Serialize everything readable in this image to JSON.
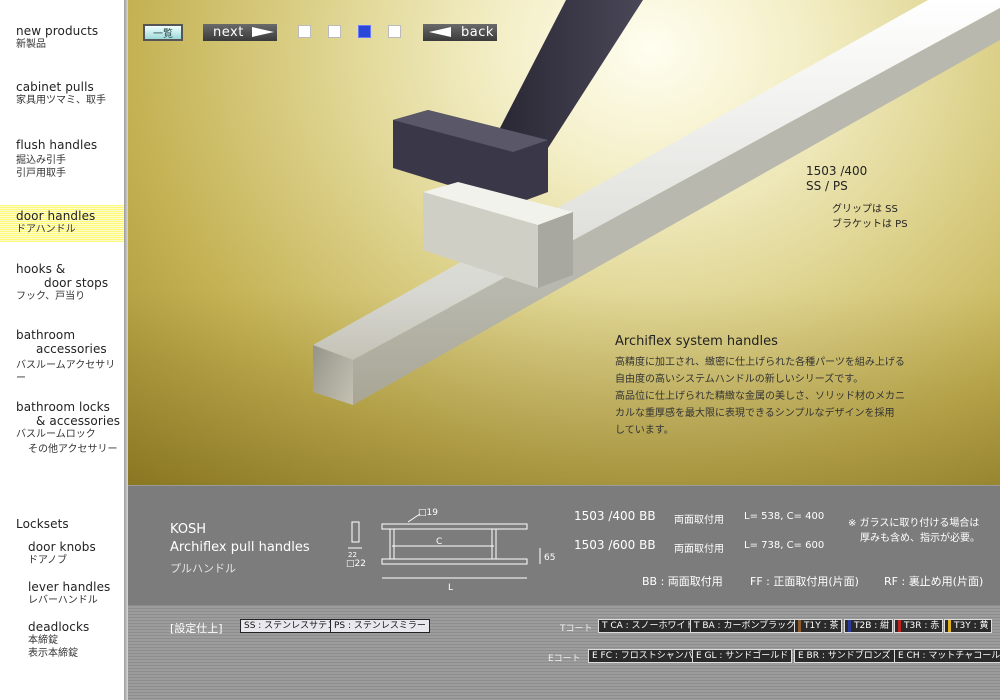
{
  "sidebar": {
    "new_products": {
      "en": "new products",
      "jp": "新製品"
    },
    "cabinet_pulls": {
      "en": "cabinet pulls",
      "jp": "家具用ツマミ、取手"
    },
    "flush_handles": {
      "en": "flush handles",
      "jp1": "掘込み引手",
      "jp2": "引戸用取手"
    },
    "door_handles": {
      "en": "door handles",
      "jp": "ドアハンドル"
    },
    "hooks": {
      "en1": "hooks &",
      "en2": "door stops",
      "jp": "フック、戸当り"
    },
    "bathroom_accessories": {
      "en1": "bathroom",
      "en2": "accessories",
      "jp": "バスルームアクセサリー"
    },
    "bathroom_locks": {
      "en1": "bathroom locks",
      "en2": "& accessories",
      "jp1": "バスルームロック",
      "jp2": "その他アクセサリー"
    },
    "locksets": {
      "title": "Locksets",
      "door_knobs": {
        "en": "door knobs",
        "jp": "ドアノブ"
      },
      "lever_handles": {
        "en": "lever handles",
        "jp": "レバーハンドル"
      },
      "deadlocks": {
        "en": "deadlocks",
        "jp1": "本締錠",
        "jp2": "表示本締錠"
      }
    }
  },
  "toolbar": {
    "list_label": "一覧",
    "next_label": "next",
    "back_label": "back",
    "active_page": 3
  },
  "hero": {
    "model": "1503 /400",
    "material": "SS / PS",
    "grip_note": "グリップは SS",
    "bracket_note": "ブラケットは PS",
    "intro_title": "Archiflex system handles",
    "intro_lines": [
      "高精度に加工され、緻密に仕上げられた各種パーツを組み上げる",
      "自由度の高いシステムハンドルの新しいシリーズです。",
      "高品位に仕上げられた精緻な金属の美しさ、ソリッド材のメカニ",
      "カルな重厚感を最大限に表現できるシンプルなデザインを採用",
      "しています。"
    ]
  },
  "spec": {
    "brand": "KOSH",
    "product": "Archiflex pull handles",
    "product_jp": "プルハンドル",
    "diagram": {
      "square": "□19",
      "c": "C",
      "l": "L",
      "h": "65",
      "w": "22",
      "s": "□22"
    },
    "rows": [
      {
        "model": "1503 /400 BB",
        "mount": "両面取付用",
        "dims": "L= 538,   C= 400"
      },
      {
        "model": "1503 /600 BB",
        "mount": "両面取付用",
        "dims": "L= 738,   C= 600"
      }
    ],
    "glass_note_1": "※ ガラスに取り付ける場合は",
    "glass_note_2": "厚みも含め、指示が必要。",
    "types": [
      {
        "code": "BB",
        "desc": "両面取付用"
      },
      {
        "code": "FF",
        "desc": "正面取付用(片面)"
      },
      {
        "code": "RF",
        "desc": "裏止め用(片面)"
      }
    ]
  },
  "finish": {
    "title": "[設定仕上]",
    "base": [
      {
        "label": "SS : ステンレスサテン"
      },
      {
        "label": "PS : ステンレスミラー"
      }
    ],
    "t_coat_label": "Tコート",
    "t_coat": [
      {
        "label": "T CA : スノーホワイト",
        "style": "light"
      },
      {
        "label": "T BA : カーボンブラック",
        "style": "light"
      },
      {
        "label": "T1Y : 茶",
        "style": "dark",
        "swatch": "#8a5a2a"
      },
      {
        "label": "T2B : 紺",
        "style": "dark",
        "swatch": "#2a3a9a"
      },
      {
        "label": "T3R : 赤",
        "style": "dark",
        "swatch": "#c02020"
      },
      {
        "label": "T3Y : 黄",
        "style": "dark",
        "swatch": "#e0b020"
      }
    ],
    "e_coat_label": "Eコート",
    "e_coat": [
      {
        "label": "E FC : フロストシャンパン"
      },
      {
        "label": "E GL : サンドゴールド"
      },
      {
        "label": "E BR : サンドブロンズ"
      },
      {
        "label": "E CH : マットチャコール"
      }
    ]
  }
}
